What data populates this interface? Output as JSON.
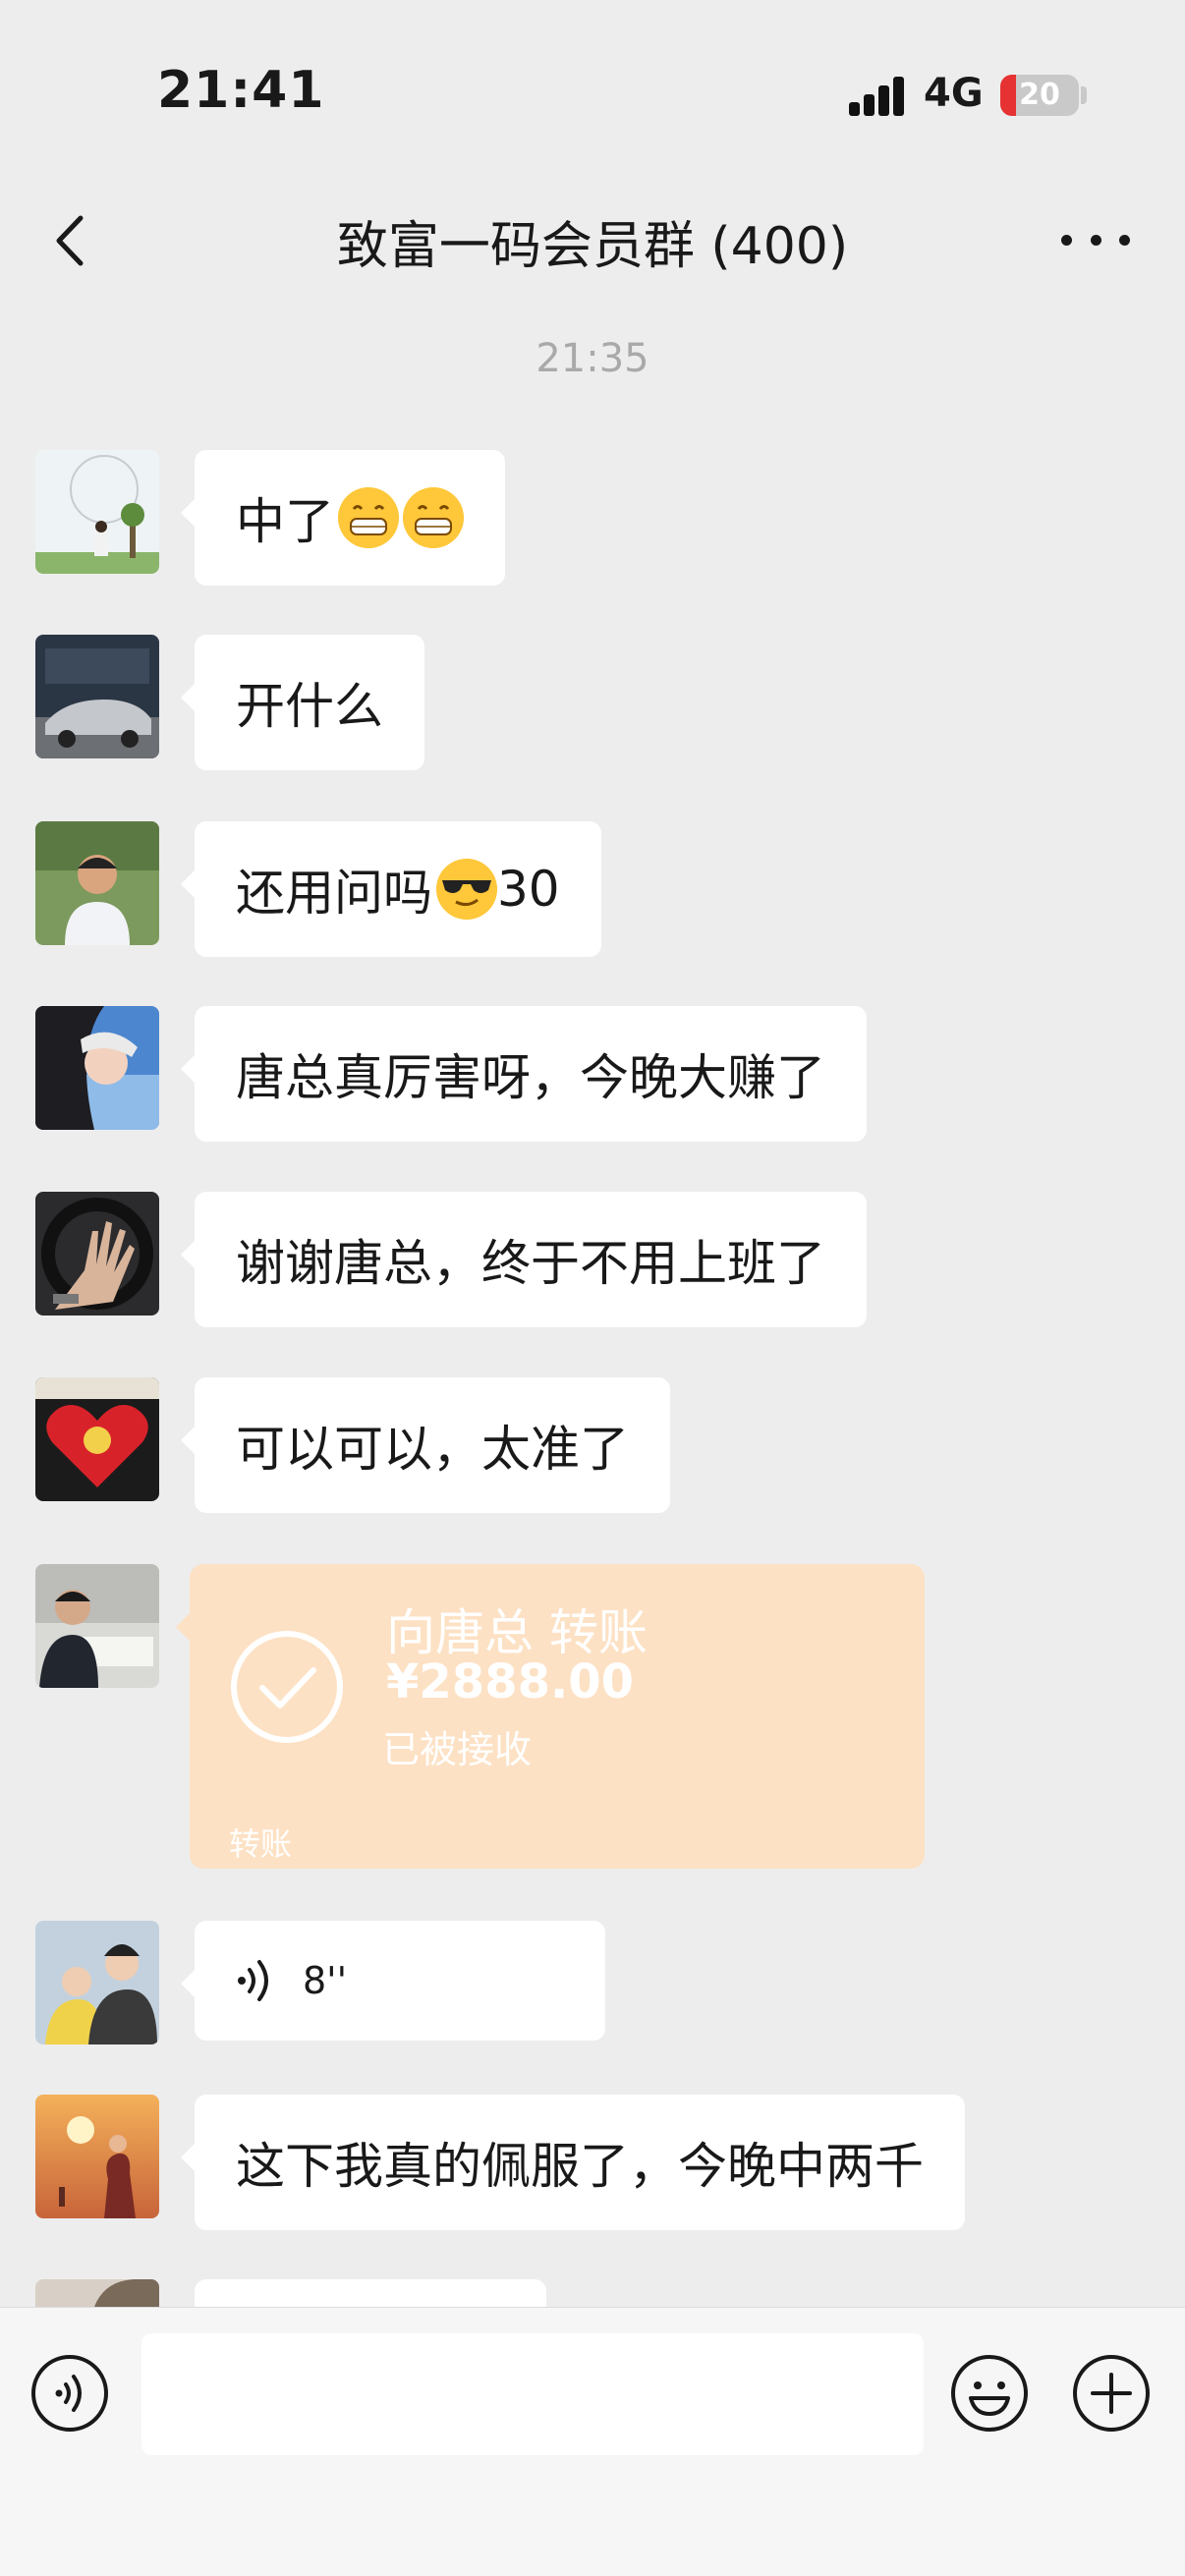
{
  "status_bar": {
    "time": "21:41",
    "network": "4G",
    "battery": "20",
    "battery_level": 0.2
  },
  "nav": {
    "title": "致富一码会员群 (400)"
  },
  "timestamp": "21:35",
  "messages": [
    {
      "type": "text",
      "text": "中了",
      "emoji": [
        "grinning-emoji",
        "grinning-emoji"
      ]
    },
    {
      "type": "text",
      "text": "开什么"
    },
    {
      "type": "text",
      "text": "还用问吗",
      "emoji_inline": "sunglasses-emoji",
      "suffix": "30"
    },
    {
      "type": "text",
      "text": "唐总真厉害呀，今晚大赚了"
    },
    {
      "type": "text",
      "text": "谢谢唐总，终于不用上班了"
    },
    {
      "type": "text",
      "text": "可以可以，太准了"
    },
    {
      "type": "transfer",
      "recipient": "向唐总 转账",
      "amount": "¥2888.00",
      "status": "已被接收",
      "label": "转账"
    },
    {
      "type": "voice",
      "duration": "8''"
    },
    {
      "type": "text",
      "text": "这下我真的佩服了，今晚中两千"
    }
  ],
  "input_bar": {
    "value": "",
    "icons": [
      "voice-icon",
      "emoji-icon",
      "plus-icon"
    ]
  },
  "colors": {
    "background": "#ededed",
    "bubble": "#ffffff",
    "transfer": "#fde1c4",
    "battery_low": "#e63232"
  }
}
